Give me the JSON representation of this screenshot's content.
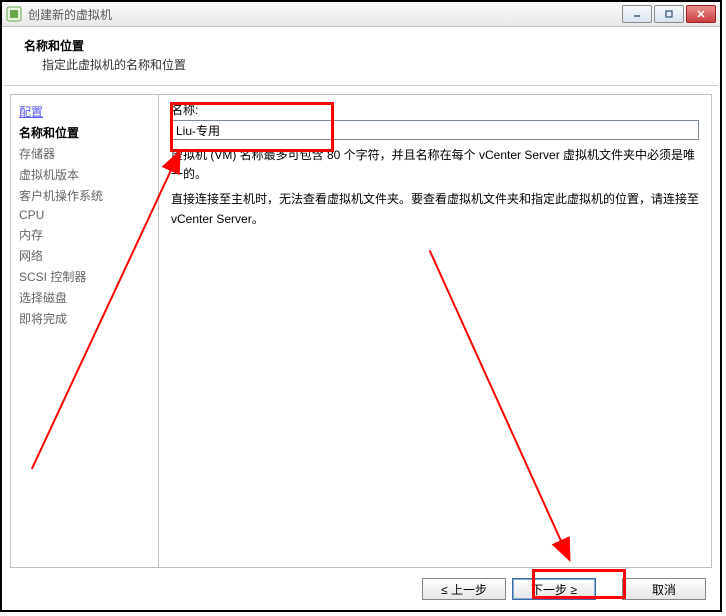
{
  "window": {
    "title": "创建新的虚拟机"
  },
  "header": {
    "title": "名称和位置",
    "subtitle": "指定此虚拟机的名称和位置"
  },
  "nav": {
    "items": [
      {
        "label": "配置",
        "state": "current-step"
      },
      {
        "label": "名称和位置",
        "state": "active-bold"
      },
      {
        "label": "存储器",
        "state": "pending"
      },
      {
        "label": "虚拟机版本",
        "state": "pending"
      },
      {
        "label": "客户机操作系统",
        "state": "pending"
      },
      {
        "label": "CPU",
        "state": "pending"
      },
      {
        "label": "内存",
        "state": "pending"
      },
      {
        "label": "网络",
        "state": "pending"
      },
      {
        "label": "SCSI 控制器",
        "state": "pending"
      },
      {
        "label": "选择磁盘",
        "state": "pending"
      },
      {
        "label": "即将完成",
        "state": "pending"
      }
    ]
  },
  "form": {
    "name_label": "名称:",
    "name_value": "Liu-专用",
    "help1": "虚拟机 (VM) 名称最多可包含 80 个字符，并且名称在每个 vCenter Server 虚拟机文件夹中必须是唯一的。",
    "help2": "直接连接至主机时，无法查看虚拟机文件夹。要查看虚拟机文件夹和指定此虚拟机的位置，请连接至 vCenter Server。"
  },
  "footer": {
    "back": "≤ 上一步",
    "next": "下一步 ≥",
    "cancel": "取消"
  }
}
